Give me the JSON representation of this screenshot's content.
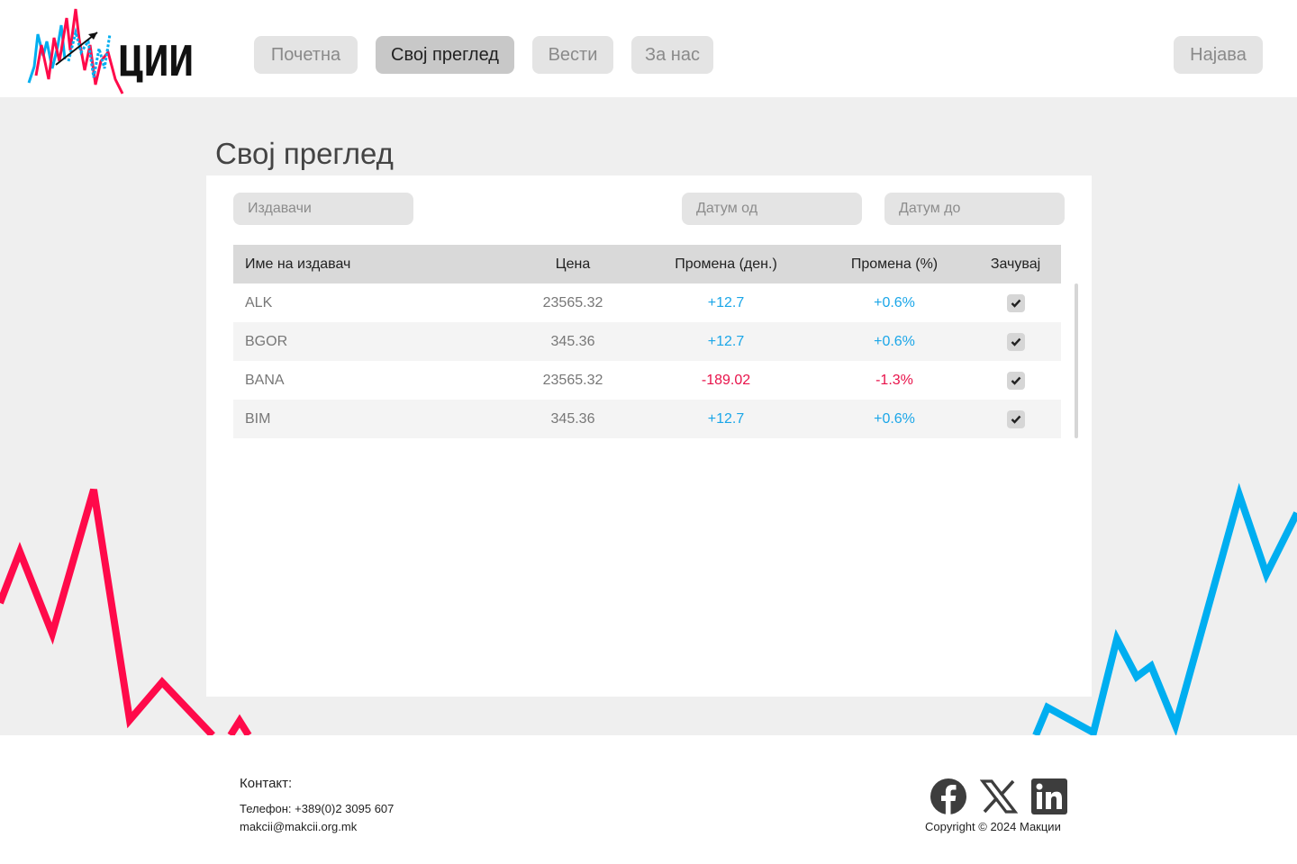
{
  "brand": {
    "logo_text": "ЦИИ",
    "logo_alt": "Макции"
  },
  "nav": {
    "items": [
      {
        "label": "Почетна",
        "active": false
      },
      {
        "label": "Свој преглед",
        "active": true
      },
      {
        "label": "Вести",
        "active": false
      },
      {
        "label": "За нас",
        "active": false
      }
    ],
    "login_label": "Најава"
  },
  "page": {
    "title": "Свој преглед"
  },
  "filters": {
    "issuers_placeholder": "Издавачи",
    "date_from_placeholder": "Датум од",
    "date_to_placeholder": "Датум до"
  },
  "table": {
    "headers": [
      "Име на издавач",
      "Цена",
      "Промена (ден.)",
      "Промена  (%)",
      "Зачувај"
    ],
    "rows": [
      {
        "name": "ALK",
        "price": "23565.32",
        "change": "+12.7",
        "change_pct": "+0.6%",
        "direction": "up",
        "saved": true
      },
      {
        "name": "BGOR",
        "price": "345.36",
        "change": "+12.7",
        "change_pct": "+0.6%",
        "direction": "up",
        "saved": true
      },
      {
        "name": "BANA",
        "price": "23565.32",
        "change": "-189.02",
        "change_pct": "-1.3%",
        "direction": "down",
        "saved": true
      },
      {
        "name": "BIM",
        "price": "345.36",
        "change": "+12.7",
        "change_pct": "+0.6%",
        "direction": "up",
        "saved": true
      }
    ]
  },
  "footer": {
    "contact_title": "Контакт:",
    "phone": "Телефон: +389(0)2 3095 607",
    "email": "makcii@makcii.org.mk",
    "copyright": "Copyright © 2024 Макции",
    "social": [
      "facebook-icon",
      "x-icon",
      "linkedin-icon"
    ]
  },
  "colors": {
    "up": "#1aa6e8",
    "down": "#e8124a",
    "accent_red": "#ff0a4a",
    "accent_blue": "#00aef0"
  }
}
